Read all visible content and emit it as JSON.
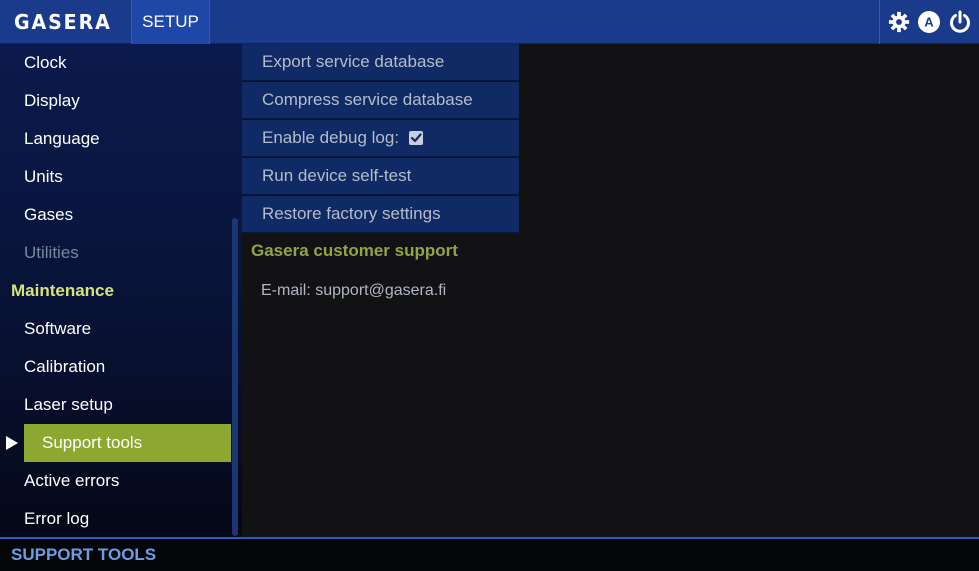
{
  "header": {
    "logo_text": "GASERA",
    "section_label": "SETUP",
    "icons": [
      "gear-icon",
      "auto-mode-icon",
      "power-icon"
    ],
    "auto_badge": "A",
    "bar_color": "#1a3a8c"
  },
  "sidebar": {
    "items": [
      {
        "label": "Clock",
        "state": "normal"
      },
      {
        "label": "Display",
        "state": "normal"
      },
      {
        "label": "Language",
        "state": "normal"
      },
      {
        "label": "Units",
        "state": "normal"
      },
      {
        "label": "Gases",
        "state": "normal"
      },
      {
        "label": "Utilities",
        "state": "disabled"
      },
      {
        "label": "Maintenance",
        "state": "heading"
      },
      {
        "label": "Software",
        "state": "normal"
      },
      {
        "label": "Calibration",
        "state": "normal"
      },
      {
        "label": "Laser setup",
        "state": "normal"
      },
      {
        "label": "Support tools",
        "state": "active"
      },
      {
        "label": "Active errors",
        "state": "normal"
      },
      {
        "label": "Error log",
        "state": "normal"
      }
    ],
    "active_color": "#8ca830",
    "heading_color": "#d7e27c"
  },
  "menu": {
    "items": [
      {
        "label": "Export service database"
      },
      {
        "label": "Compress service database"
      },
      {
        "label": "Enable debug log:",
        "checked": true
      },
      {
        "label": "Run device self-test"
      },
      {
        "label": "Restore factory settings"
      }
    ]
  },
  "support": {
    "heading": "Gasera customer support",
    "email": "E-mail: support@gasera.fi"
  },
  "status": {
    "label": "SUPPORT TOOLS"
  }
}
